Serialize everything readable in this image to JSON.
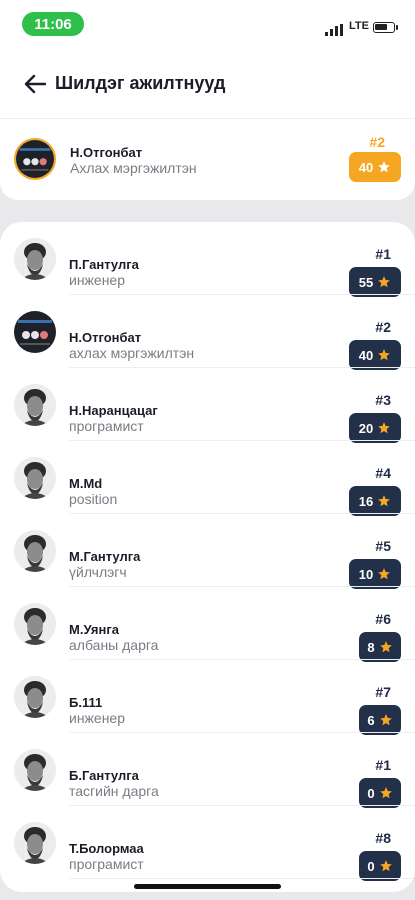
{
  "status_bar": {
    "time": "11:06",
    "network": "LTE"
  },
  "header": {
    "title": "Шилдэг ажилтнууд"
  },
  "current_user": {
    "name": "Н.Отгонбат",
    "role": "Ахлах мэргэжилтэн",
    "rank": "#2",
    "score": "40"
  },
  "colors": {
    "accent": "#f5a623",
    "score_badge": "#233049",
    "status_pill": "#2fbf4a"
  },
  "employees": [
    {
      "name": "П.Гантулга",
      "role": "инженер",
      "rank": "#1",
      "score": "55",
      "avatar": "sketch"
    },
    {
      "name": "Н.Отгонбат",
      "role": "ахлах мэргэжилтэн",
      "rank": "#2",
      "score": "40",
      "avatar": "dark"
    },
    {
      "name": "Н.Наранцацаг",
      "role": "програмист",
      "rank": "#3",
      "score": "20",
      "avatar": "sketch"
    },
    {
      "name": "M.Md",
      "role": "position",
      "rank": "#4",
      "score": "16",
      "avatar": "sketch"
    },
    {
      "name": "М.Гантулга",
      "role": "үйлчлэгч",
      "rank": "#5",
      "score": "10",
      "avatar": "sketch"
    },
    {
      "name": "М.Уянга",
      "role": "албаны дарга",
      "rank": "#6",
      "score": "8",
      "avatar": "sketch"
    },
    {
      "name": "Б.111",
      "role": "инженер",
      "rank": "#7",
      "score": "6",
      "avatar": "sketch"
    },
    {
      "name": "Б.Гантулга",
      "role": "тасгийн дарга",
      "rank": "#1",
      "score": "0",
      "avatar": "sketch"
    },
    {
      "name": "Т.Болормаа",
      "role": "програмист",
      "rank": "#8",
      "score": "0",
      "avatar": "sketch"
    }
  ]
}
